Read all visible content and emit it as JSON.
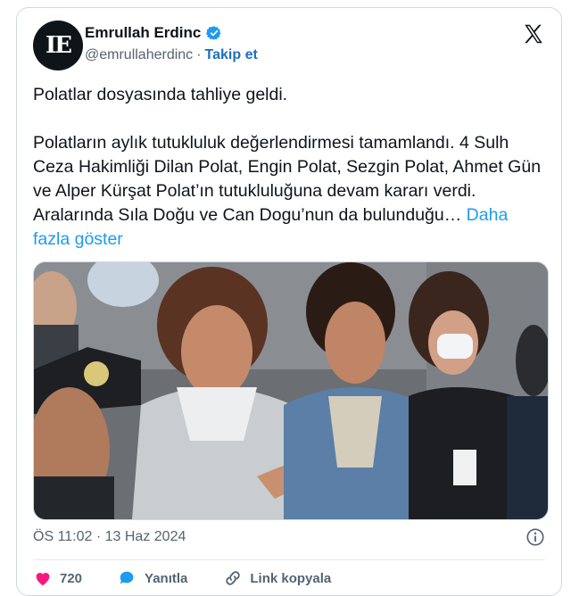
{
  "author": {
    "name": "Emrullah Erdinc",
    "handle": "@emrullaherdinc",
    "separator": "·",
    "follow_label": "Takip et",
    "avatar_letters": "IE"
  },
  "tweet": {
    "paragraph1": "Polatlar dosyasında tahliye geldi.",
    "paragraph2": "Polatların aylık tutukluluk değerlendirmesi tamamlandı. 4 Sulh Ceza Hakimliği Dilan Polat, Engin Polat, Sezgin Polat, Ahmet Gün ve Alper Kürşat Polat’ın tutukluluğuna devam kararı verdi. Aralarında Sıla Doğu ve Can Dogu’nun da bulunduğu…",
    "show_more": "Daha fazla göster"
  },
  "timestamp": "ÖS 11:02 · 13 Haz 2024",
  "actions": {
    "likes": "720",
    "reply_label": "Yanıtla",
    "copy_link_label": "Link kopyala"
  },
  "colors": {
    "brand_blue": "#1d9bf0",
    "follow_blue": "#1d6ec2",
    "like_red": "#f91880",
    "text": "#0f1419",
    "muted": "#536471"
  },
  "icons": [
    "verified-badge-icon",
    "x-logo-icon",
    "info-icon",
    "heart-icon",
    "reply-icon",
    "link-icon"
  ]
}
